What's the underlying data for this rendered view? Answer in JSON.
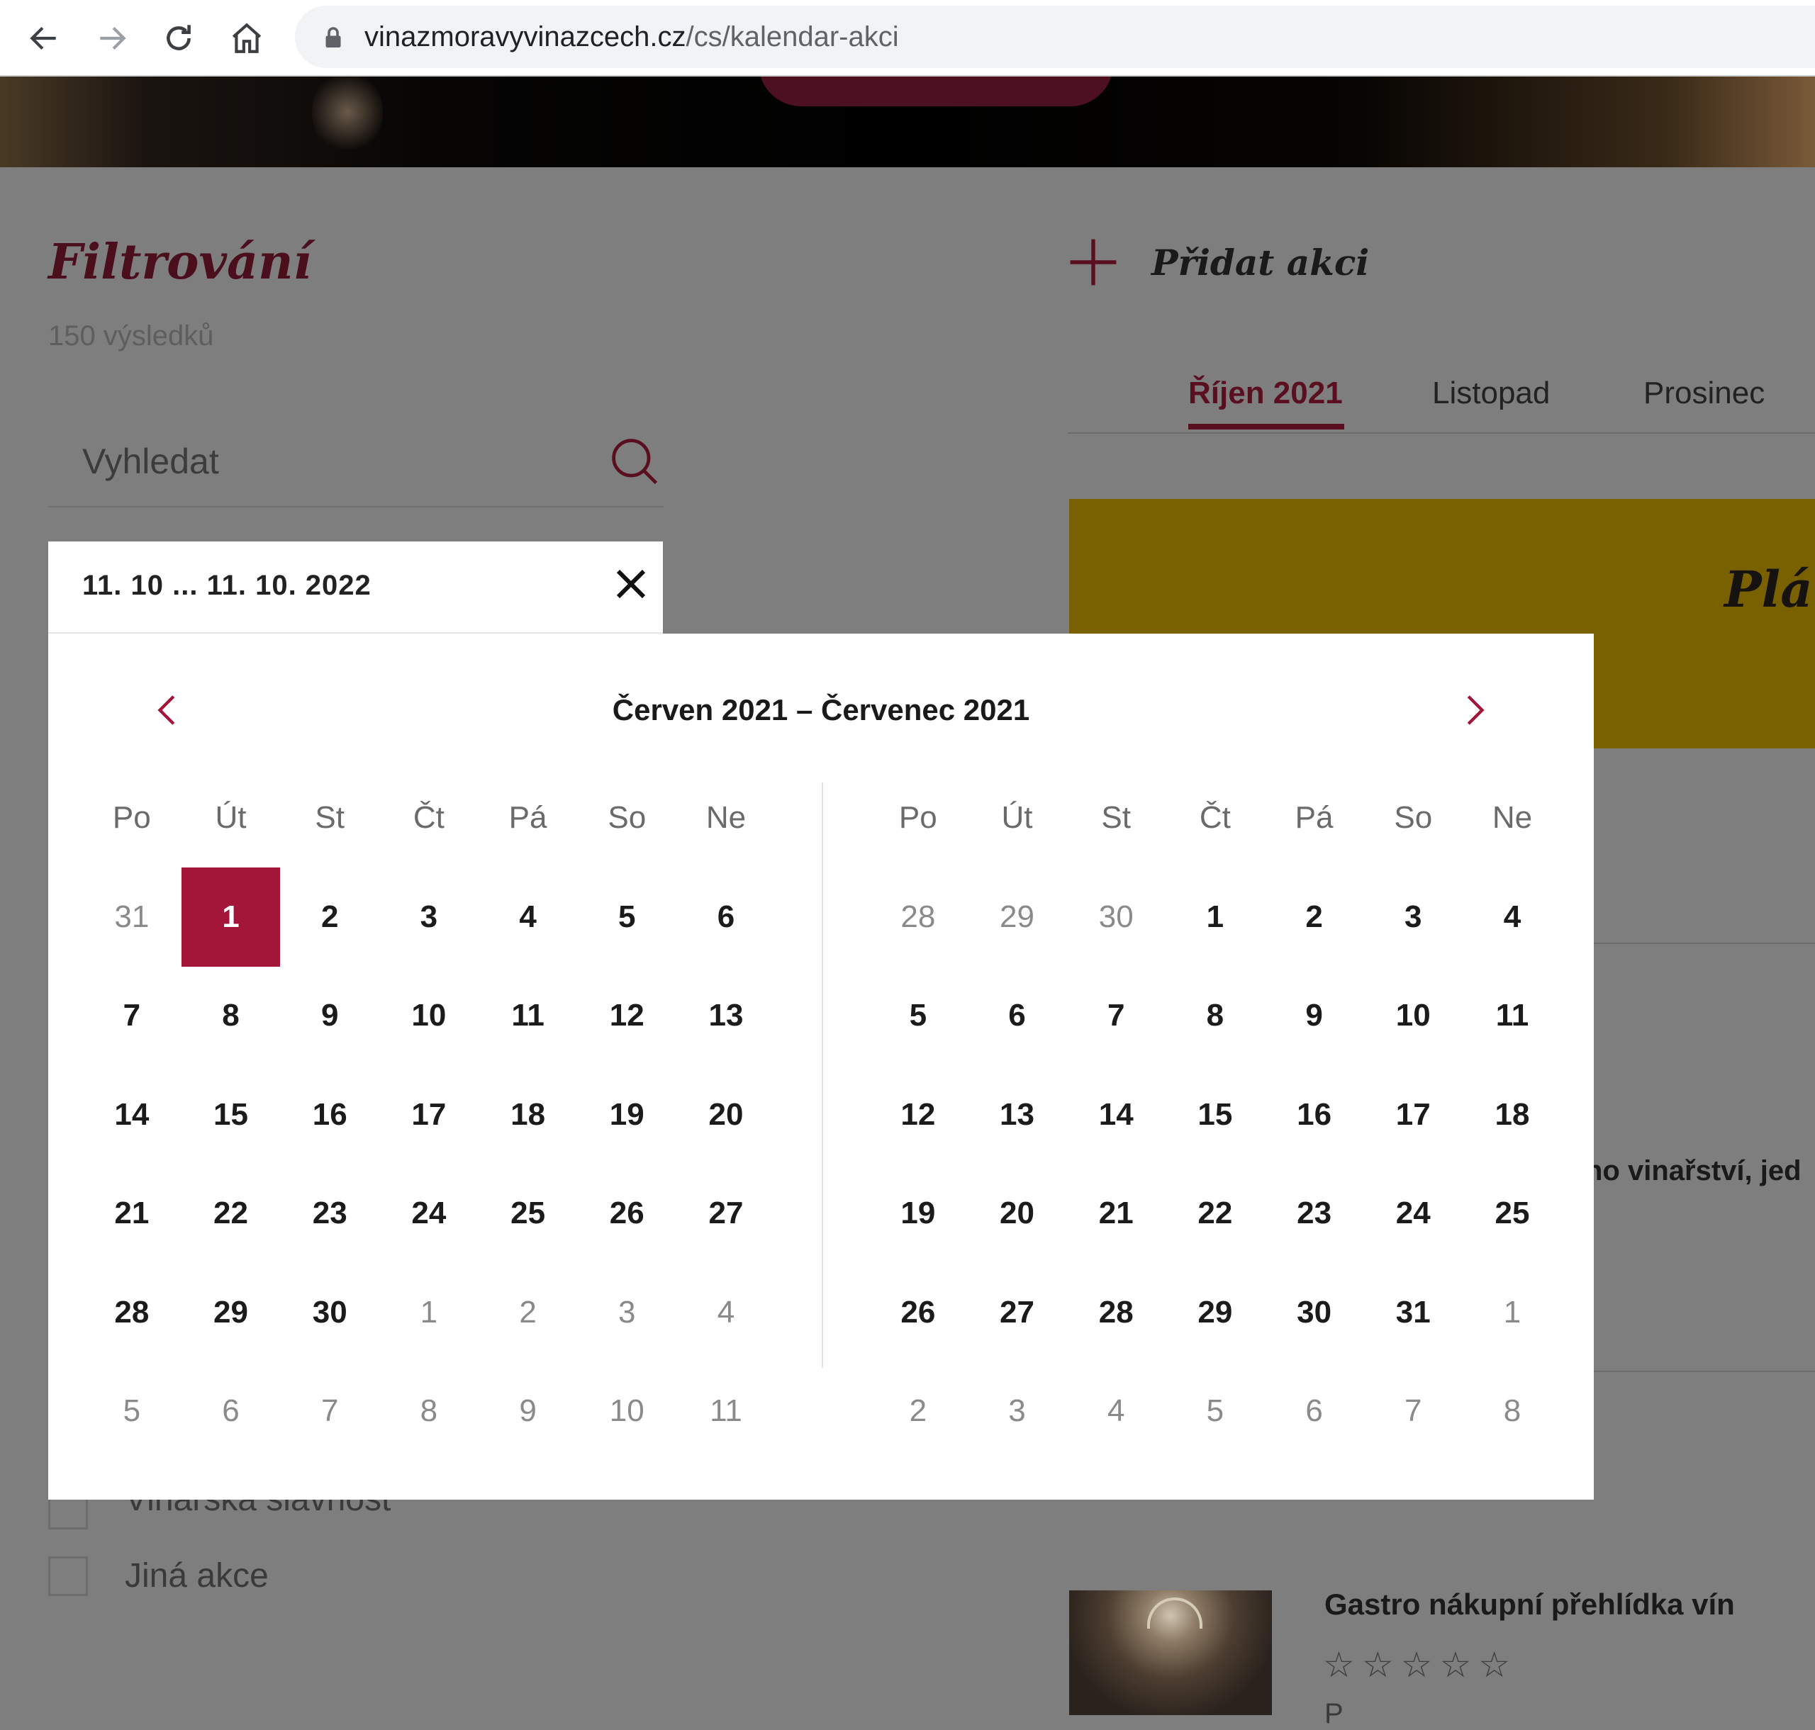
{
  "browser": {
    "url_host": "vinazmoravyvinazcech.cz",
    "url_path": "/cs/kalendar-akci"
  },
  "filter": {
    "title": "Filtrování",
    "results": "150 výsledků",
    "search_placeholder": "Vyhledat",
    "date_range": "11. 10 ... 11. 10. 2022"
  },
  "add_event": {
    "label": "Přidat akci"
  },
  "month_tabs": [
    {
      "label": "Říjen 2021",
      "active": true
    },
    {
      "label": "Listopad",
      "active": false
    },
    {
      "label": "Prosinec",
      "active": false
    }
  ],
  "banner": {
    "text": "Plán"
  },
  "background_snippet": "no vinařství, jed",
  "checkboxes": [
    {
      "label": "Vinařská slavnost"
    },
    {
      "label": "Jiná akce"
    }
  ],
  "event": {
    "title": "Gastro nákupní přehlídka vín",
    "stars": "☆☆☆☆☆",
    "more": "P"
  },
  "calendar": {
    "title": "Červen 2021 – Červenec 2021",
    "accent": "#a3163a",
    "weekdays": [
      "Po",
      "Út",
      "St",
      "Čt",
      "Pá",
      "So",
      "Ne"
    ],
    "months": [
      {
        "name": "Červen 2021",
        "weeks": [
          [
            {
              "d": "31",
              "o": true
            },
            {
              "d": "1",
              "s": true
            },
            {
              "d": "2"
            },
            {
              "d": "3"
            },
            {
              "d": "4"
            },
            {
              "d": "5"
            },
            {
              "d": "6"
            }
          ],
          [
            {
              "d": "7"
            },
            {
              "d": "8"
            },
            {
              "d": "9"
            },
            {
              "d": "10"
            },
            {
              "d": "11"
            },
            {
              "d": "12"
            },
            {
              "d": "13"
            }
          ],
          [
            {
              "d": "14"
            },
            {
              "d": "15"
            },
            {
              "d": "16"
            },
            {
              "d": "17"
            },
            {
              "d": "18"
            },
            {
              "d": "19"
            },
            {
              "d": "20"
            }
          ],
          [
            {
              "d": "21"
            },
            {
              "d": "22"
            },
            {
              "d": "23"
            },
            {
              "d": "24"
            },
            {
              "d": "25"
            },
            {
              "d": "26"
            },
            {
              "d": "27"
            }
          ],
          [
            {
              "d": "28"
            },
            {
              "d": "29"
            },
            {
              "d": "30"
            },
            {
              "d": "1",
              "o": true
            },
            {
              "d": "2",
              "o": true
            },
            {
              "d": "3",
              "o": true
            },
            {
              "d": "4",
              "o": true
            }
          ],
          [
            {
              "d": "5",
              "o": true
            },
            {
              "d": "6",
              "o": true
            },
            {
              "d": "7",
              "o": true
            },
            {
              "d": "8",
              "o": true
            },
            {
              "d": "9",
              "o": true
            },
            {
              "d": "10",
              "o": true
            },
            {
              "d": "11",
              "o": true
            }
          ]
        ]
      },
      {
        "name": "Červenec 2021",
        "weeks": [
          [
            {
              "d": "28",
              "o": true
            },
            {
              "d": "29",
              "o": true
            },
            {
              "d": "30",
              "o": true
            },
            {
              "d": "1"
            },
            {
              "d": "2"
            },
            {
              "d": "3"
            },
            {
              "d": "4"
            }
          ],
          [
            {
              "d": "5"
            },
            {
              "d": "6"
            },
            {
              "d": "7"
            },
            {
              "d": "8"
            },
            {
              "d": "9"
            },
            {
              "d": "10"
            },
            {
              "d": "11"
            }
          ],
          [
            {
              "d": "12"
            },
            {
              "d": "13"
            },
            {
              "d": "14"
            },
            {
              "d": "15"
            },
            {
              "d": "16"
            },
            {
              "d": "17"
            },
            {
              "d": "18"
            }
          ],
          [
            {
              "d": "19"
            },
            {
              "d": "20"
            },
            {
              "d": "21"
            },
            {
              "d": "22"
            },
            {
              "d": "23"
            },
            {
              "d": "24"
            },
            {
              "d": "25"
            }
          ],
          [
            {
              "d": "26"
            },
            {
              "d": "27"
            },
            {
              "d": "28"
            },
            {
              "d": "29"
            },
            {
              "d": "30"
            },
            {
              "d": "31"
            },
            {
              "d": "1",
              "o": true
            }
          ],
          [
            {
              "d": "2",
              "o": true
            },
            {
              "d": "3",
              "o": true
            },
            {
              "d": "4",
              "o": true
            },
            {
              "d": "5",
              "o": true
            },
            {
              "d": "6",
              "o": true
            },
            {
              "d": "7",
              "o": true
            },
            {
              "d": "8",
              "o": true
            }
          ]
        ]
      }
    ]
  }
}
